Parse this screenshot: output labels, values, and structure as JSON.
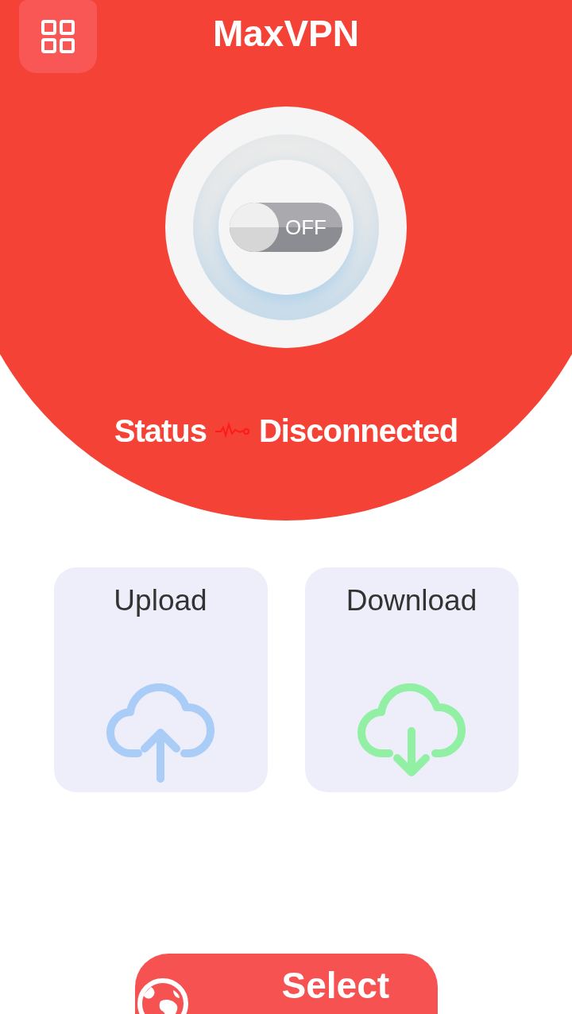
{
  "app_bar": {
    "title": "MaxVPN"
  },
  "connect_toggle": {
    "label": "OFF",
    "on": false
  },
  "status": {
    "label": "Status",
    "value": "Disconnected"
  },
  "speed_cards": [
    {
      "kind": "upload",
      "label": "Upload"
    },
    {
      "kind": "download",
      "label": "Download"
    }
  ],
  "location_button": {
    "label": "Select"
  }
}
